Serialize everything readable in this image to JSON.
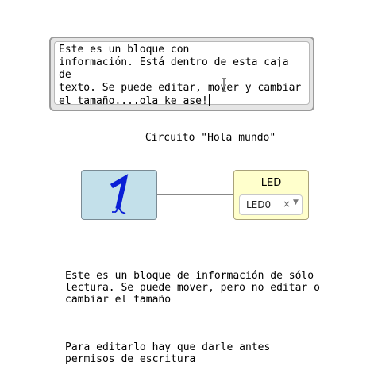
{
  "editable_block": {
    "text": "Este es un bloque con\ninformación. Está dentro de esta caja de\ntexto. Se puede editar, mover y cambiar\nel tamaño....ola ke ase!"
  },
  "circuit": {
    "title": "Circuito \"Hola mundo\""
  },
  "block_one": {
    "icon": "digit-one-walking-icon",
    "color": "#c3e0ea"
  },
  "led_block": {
    "title": "LED",
    "selected": "LED0",
    "clear_glyph": "×",
    "color": "#ffffcc"
  },
  "readonly_block": {
    "paragraph1": "Este es un bloque de información de sólo\nlectura. Se puede mover, pero no editar o\ncambiar el tamaño",
    "paragraph2": "Para editarlo hay que darle antes\npermisos de escritura"
  }
}
